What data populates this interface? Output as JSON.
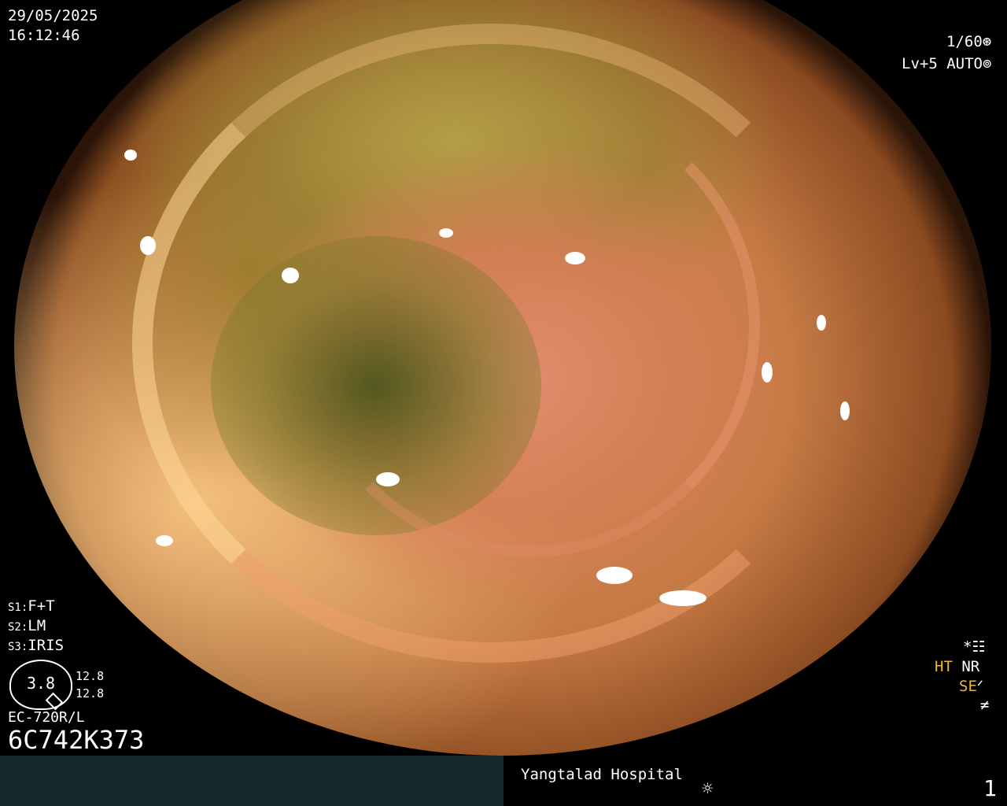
{
  "datetime": {
    "date": "29/05/2025",
    "time": "16:12:46"
  },
  "shutter": {
    "value": "1/60",
    "icon": "shutter-icon"
  },
  "exposure": {
    "level": "Lv+5",
    "mode": "AUTO",
    "icon": "iris-icon"
  },
  "settings": {
    "s1": {
      "key": "S1:",
      "value": "F+T"
    },
    "s2": {
      "key": "S2:",
      "value": "LM"
    },
    "s3": {
      "key": "S3:",
      "value": "IRIS"
    }
  },
  "brightness": {
    "value": "3.8",
    "upper": "12.8",
    "lower": "12.8"
  },
  "scope": {
    "model": "EC-720R/L",
    "serial": "6C742K373"
  },
  "enhancement": {
    "star": "*",
    "ht": "HT",
    "nr": "NR",
    "se": "SE",
    "colors": {
      "ht": "#f2b33a",
      "se": "#f2b33a",
      "default": "#ffffff"
    }
  },
  "footer": {
    "hospital": "Yangtalad Hospital",
    "lamp_icon": "sun-icon",
    "page": "1"
  },
  "colors": {
    "footer_left_bg": "#15292c",
    "background": "#000000"
  }
}
